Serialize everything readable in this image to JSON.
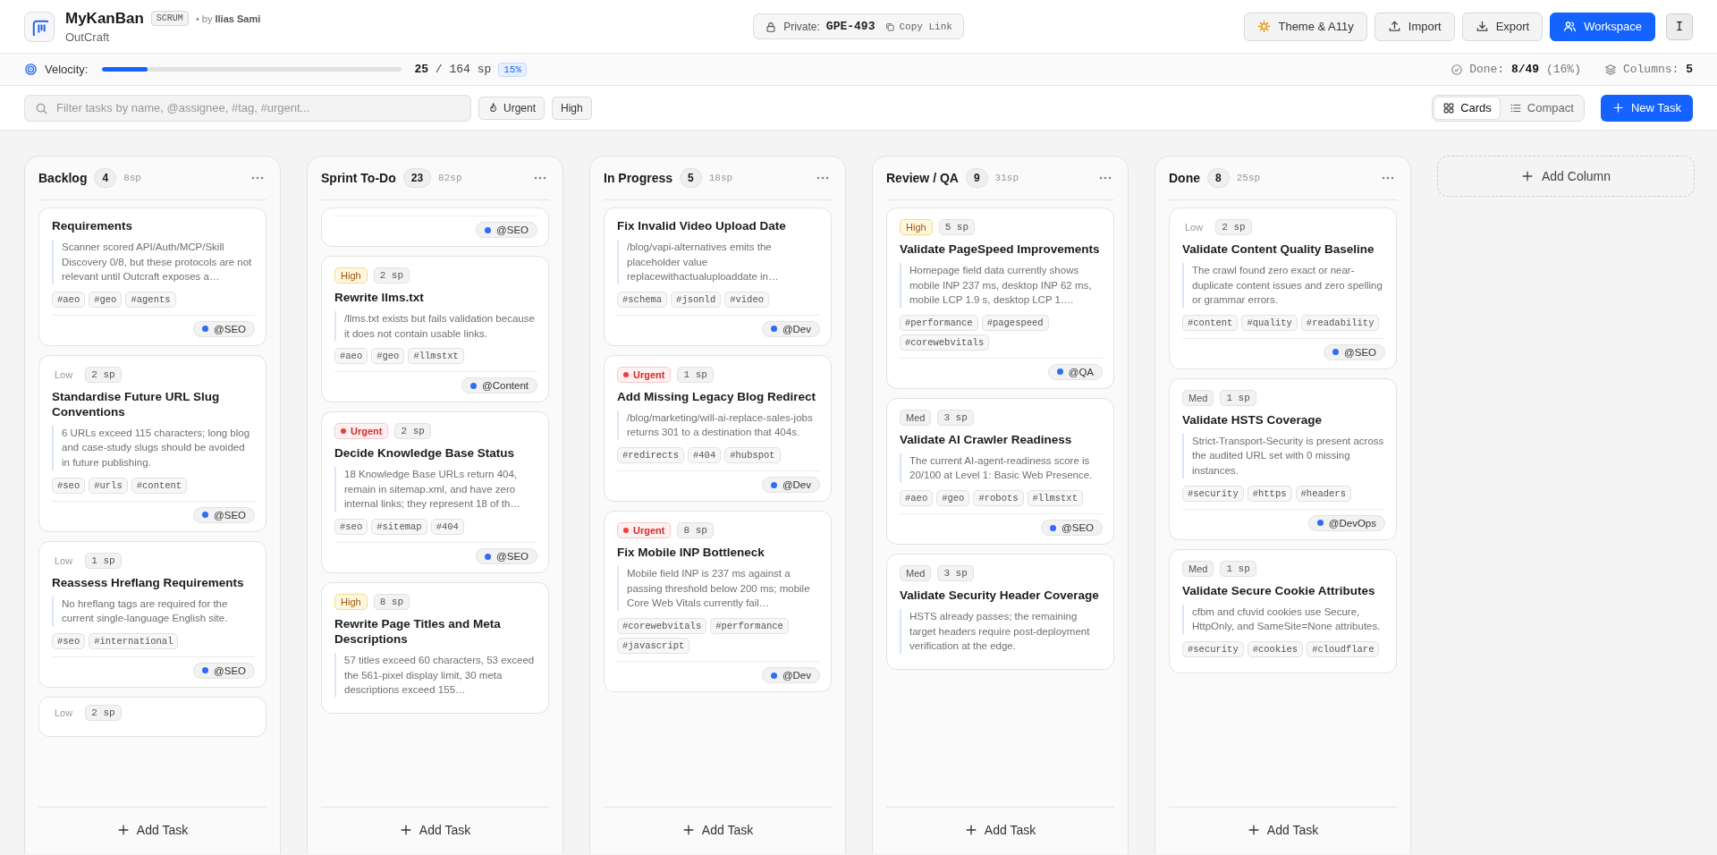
{
  "app": {
    "title": "MyKanBan",
    "badge": "SCRUM",
    "byline": "• by **Ilias Sami**",
    "subtitle": "OutCraft"
  },
  "share": {
    "privacy": "Private:",
    "code": "GPE-493",
    "copy": "Copy Link"
  },
  "actions": [
    {
      "label": "Theme & A11y",
      "kind": "theme"
    },
    {
      "label": "Import",
      "kind": "import"
    },
    {
      "label": "Export",
      "kind": "export"
    },
    {
      "label": "Workspace",
      "kind": "workspace"
    }
  ],
  "avatar": "I",
  "stats": {
    "velocity_label": "Velocity:",
    "level": 0.15,
    "velocity": "**25** / 164 sp",
    "percent": "15%",
    "done": "Done: **8/49** (16%)",
    "columns": "Columns: **5**"
  },
  "toolbar": {
    "search": {
      "placeholder": "Filter tasks by name, @assignee, #tag, #urgent..."
    },
    "filters": [
      {
        "label": "Urgent",
        "kind": "flame",
        "selected": false
      },
      {
        "label": "High",
        "kind": "plain",
        "selected": false
      }
    ],
    "views": [
      {
        "label": "Cards",
        "kind": "grid",
        "selected": true
      },
      {
        "label": "Compact",
        "kind": "list",
        "selected": false
      }
    ],
    "new_task": "New Task"
  },
  "columns": [
    {
      "name": "Backlog",
      "count": "4",
      "points": "8sp",
      "add": "Add Task",
      "cards": [
        {
          "title": "Requirements",
          "description": "Scanner scored API/Auth/MCP/Skill Discovery 0/8, but these protocols are not relevant until Outcraft exposes a…",
          "tags": [
            "#aeo",
            "#geo",
            "#agents"
          ],
          "assignee": "@SEO"
        },
        {
          "priority": {
            "label": "Low",
            "kind": "low"
          },
          "points": "2 sp",
          "title": "Standardise Future URL Slug Conventions",
          "description": "6 URLs exceed 115 characters; long blog and case-study slugs should be avoided in future publishing.",
          "tags": [
            "#seo",
            "#urls",
            "#content"
          ],
          "assignee": "@SEO"
        },
        {
          "priority": {
            "label": "Low",
            "kind": "low"
          },
          "points": "1 sp",
          "title": "Reassess Hreflang Requirements",
          "description": "No hreflang tags are required for the current single-language English site.",
          "tags": [
            "#seo",
            "#international"
          ],
          "assignee": "@SEO"
        },
        {
          "priority": {
            "label": "Low",
            "kind": "low"
          },
          "points": "2 sp"
        }
      ]
    },
    {
      "name": "Sprint To-Do",
      "count": "23",
      "points": "82sp",
      "add": "Add Task",
      "cards": [
        {
          "assignee": "@SEO"
        },
        {
          "priority": {
            "label": "High",
            "kind": "high"
          },
          "points": "2 sp",
          "title": "Rewrite llms.txt",
          "description": "/llms.txt exists but fails validation because it does not contain usable links.",
          "tags": [
            "#aeo",
            "#geo",
            "#llmstxt"
          ],
          "assignee": "@Content"
        },
        {
          "priority": {
            "label": "Urgent",
            "kind": "urgent"
          },
          "points": "2 sp",
          "title": "Decide Knowledge Base Status",
          "description": "18 Knowledge Base URLs return 404, remain in sitemap.xml, and have zero internal links; they represent 18 of th…",
          "tags": [
            "#seo",
            "#sitemap",
            "#404"
          ],
          "assignee": "@SEO"
        },
        {
          "priority": {
            "label": "High",
            "kind": "high"
          },
          "points": "8 sp",
          "title": "Rewrite Page Titles and Meta Descriptions",
          "description": "57 titles exceed 60 characters, 53 exceed the 561-pixel display limit, 30 meta descriptions exceed 155…"
        }
      ]
    },
    {
      "name": "In Progress",
      "count": "5",
      "points": "18sp",
      "add": "Add Task",
      "cards": [
        {
          "title": "Fix Invalid Video Upload Date",
          "description": "/blog/vapi-alternatives emits the placeholder value replacewithactualuploaddate in…",
          "tags": [
            "#schema",
            "#jsonld",
            "#video"
          ],
          "assignee": "@Dev"
        },
        {
          "priority": {
            "label": "Urgent",
            "kind": "urgent"
          },
          "points": "1 sp",
          "title": "Add Missing Legacy Blog Redirect",
          "description": "/blog/marketing/will-ai-replace-sales-jobs returns 301 to a destination that 404s.",
          "tags": [
            "#redirects",
            "#404",
            "#hubspot"
          ],
          "assignee": "@Dev"
        },
        {
          "priority": {
            "label": "Urgent",
            "kind": "urgent"
          },
          "points": "8 sp",
          "title": "Fix Mobile INP Bottleneck",
          "description": "Mobile field INP is 237 ms against a passing threshold below 200 ms; mobile Core Web Vitals currently fail…",
          "tags": [
            "#corewebvitals",
            "#performance",
            "#javascript"
          ],
          "assignee": "@Dev"
        }
      ]
    },
    {
      "name": "Review / QA",
      "count": "9",
      "points": "31sp",
      "add": "Add Task",
      "cards": [
        {
          "priority": {
            "label": "High",
            "kind": "high"
          },
          "points": "5 sp",
          "title": "Validate PageSpeed Improvements",
          "description": "Homepage field data currently shows mobile INP 237 ms, desktop INP 62 ms, mobile LCP 1.9 s, desktop LCP 1.…",
          "tags": [
            "#performance",
            "#pagespeed",
            "#corewebvitals"
          ],
          "assignee": "@QA"
        },
        {
          "priority": {
            "label": "Med",
            "kind": "med"
          },
          "points": "3 sp",
          "title": "Validate AI Crawler Readiness",
          "description": "The current AI-agent-readiness score is 20/100 at Level 1: Basic Web Presence.",
          "tags": [
            "#aeo",
            "#geo",
            "#robots",
            "#llmstxt"
          ],
          "assignee": "@SEO"
        },
        {
          "priority": {
            "label": "Med",
            "kind": "med"
          },
          "points": "3 sp",
          "title": "Validate Security Header Coverage",
          "description": "HSTS already passes; the remaining target headers require post-deployment verification at the edge."
        }
      ]
    },
    {
      "name": "Done",
      "count": "8",
      "points": "25sp",
      "add": "Add Task",
      "cards": [
        {
          "priority": {
            "label": "Low",
            "kind": "low"
          },
          "points": "2 sp",
          "title": "Validate Content Quality Baseline",
          "description": "The crawl found zero exact or near-duplicate content issues and zero spelling or grammar errors.",
          "tags": [
            "#content",
            "#quality",
            "#readability"
          ],
          "assignee": "@SEO"
        },
        {
          "priority": {
            "label": "Med",
            "kind": "med"
          },
          "points": "1 sp",
          "title": "Validate HSTS Coverage",
          "description": "Strict-Transport-Security is present across the audited URL set with 0 missing instances.",
          "tags": [
            "#security",
            "#https",
            "#headers"
          ],
          "assignee": "@DevOps"
        },
        {
          "priority": {
            "label": "Med",
            "kind": "med"
          },
          "points": "1 sp",
          "title": "Validate Secure Cookie Attributes",
          "description": "cfbm and cfuvid cookies use Secure, HttpOnly, and SameSite=None attributes.",
          "tags": [
            "#security",
            "#cookies",
            "#cloudflare"
          ]
        }
      ]
    }
  ],
  "add_column": "Add Column"
}
